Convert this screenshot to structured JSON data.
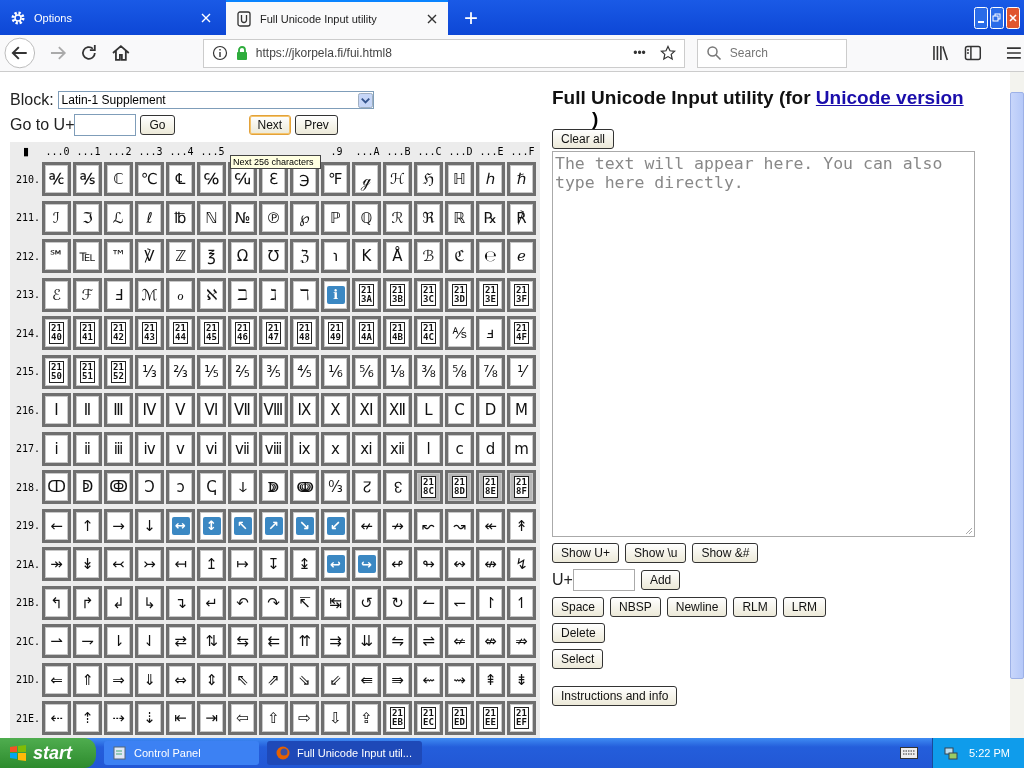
{
  "browser": {
    "tabs": [
      {
        "title": "Options",
        "selected": false
      },
      {
        "title": "Full Unicode Input utility",
        "selected": true
      }
    ],
    "new_tab": "+",
    "url": "https://jkorpela.fi/fui.html8",
    "page_actions": "•••",
    "search": {
      "placeholder": "Search"
    }
  },
  "page": {
    "block_label": "Block:",
    "block_value": "Latin-1 Supplement",
    "goto_label": "Go to U+",
    "go": "Go",
    "nav_buttons": [
      {
        "label": "Next",
        "hover": true
      },
      {
        "label": "Prev",
        "hover": false
      }
    ],
    "corner": "▮",
    "column_headers": [
      "...0",
      "...1",
      "...2",
      "...3",
      "...4",
      "...5"
    ],
    "tooltip": "Next 256 characters",
    "column_headers_after": [
      ".9",
      "...A",
      "...B",
      "...C",
      "...D",
      "...E",
      "...F"
    ],
    "rows": [
      {
        "label": "210.",
        "cells": [
          {
            "kind": "char",
            "text": "℀"
          },
          {
            "kind": "char",
            "text": "℁"
          },
          {
            "kind": "char",
            "text": "ℂ"
          },
          {
            "kind": "char",
            "text": "℃"
          },
          {
            "kind": "char",
            "text": "℄"
          },
          {
            "kind": "char",
            "text": "℅"
          },
          {
            "kind": "char",
            "text": "℆"
          },
          {
            "kind": "char",
            "text": "ℇ"
          },
          {
            "kind": "char",
            "text": "℈"
          },
          {
            "kind": "char",
            "text": "℉"
          },
          {
            "kind": "char",
            "text": "ℊ"
          },
          {
            "kind": "char",
            "text": "ℋ"
          },
          {
            "kind": "char",
            "text": "ℌ"
          },
          {
            "kind": "char",
            "text": "ℍ"
          },
          {
            "kind": "char",
            "text": "ℎ"
          },
          {
            "kind": "char",
            "text": "ℏ"
          }
        ]
      },
      {
        "label": "211.",
        "cells": [
          {
            "kind": "char",
            "text": "ℐ"
          },
          {
            "kind": "char",
            "text": "ℑ"
          },
          {
            "kind": "char",
            "text": "ℒ"
          },
          {
            "kind": "char",
            "text": "ℓ"
          },
          {
            "kind": "char",
            "text": "℔"
          },
          {
            "kind": "char",
            "text": "ℕ"
          },
          {
            "kind": "char",
            "text": "№"
          },
          {
            "kind": "char",
            "text": "℗"
          },
          {
            "kind": "char",
            "text": "℘"
          },
          {
            "kind": "char",
            "text": "ℙ"
          },
          {
            "kind": "char",
            "text": "ℚ"
          },
          {
            "kind": "char",
            "text": "ℛ"
          },
          {
            "kind": "char",
            "text": "ℜ"
          },
          {
            "kind": "char",
            "text": "ℝ"
          },
          {
            "kind": "char",
            "text": "℞"
          },
          {
            "kind": "char",
            "text": "℟"
          }
        ]
      },
      {
        "label": "212.",
        "cells": [
          {
            "kind": "char",
            "text": "℠"
          },
          {
            "kind": "char",
            "text": "℡"
          },
          {
            "kind": "char",
            "text": "™"
          },
          {
            "kind": "char",
            "text": "℣"
          },
          {
            "kind": "char",
            "text": "ℤ"
          },
          {
            "kind": "char",
            "text": "℥"
          },
          {
            "kind": "char",
            "text": "Ω"
          },
          {
            "kind": "char",
            "text": "℧"
          },
          {
            "kind": "char",
            "text": "ℨ"
          },
          {
            "kind": "char",
            "text": "℩"
          },
          {
            "kind": "char",
            "text": "K"
          },
          {
            "kind": "char",
            "text": "Å"
          },
          {
            "kind": "char",
            "text": "ℬ"
          },
          {
            "kind": "char",
            "text": "ℭ"
          },
          {
            "kind": "char",
            "text": "℮"
          },
          {
            "kind": "char",
            "text": "ℯ"
          }
        ]
      },
      {
        "label": "213.",
        "cells": [
          {
            "kind": "char",
            "text": "ℰ"
          },
          {
            "kind": "char",
            "text": "ℱ"
          },
          {
            "kind": "char",
            "text": "Ⅎ"
          },
          {
            "kind": "char",
            "text": "ℳ"
          },
          {
            "kind": "char",
            "text": "ℴ"
          },
          {
            "kind": "char",
            "text": "ℵ"
          },
          {
            "kind": "char",
            "text": "ℶ"
          },
          {
            "kind": "char",
            "text": "ℷ"
          },
          {
            "kind": "char",
            "text": "ℸ"
          },
          {
            "kind": "emoji",
            "text": "ℹ"
          },
          {
            "kind": "code",
            "text": "213A"
          },
          {
            "kind": "code",
            "text": "213B"
          },
          {
            "kind": "code",
            "text": "213C"
          },
          {
            "kind": "code",
            "text": "213D"
          },
          {
            "kind": "code",
            "text": "213E"
          },
          {
            "kind": "code",
            "text": "213F"
          }
        ]
      },
      {
        "label": "214.",
        "cells": [
          {
            "kind": "code",
            "text": "2140"
          },
          {
            "kind": "code",
            "text": "2141"
          },
          {
            "kind": "code",
            "text": "2142"
          },
          {
            "kind": "code",
            "text": "2143"
          },
          {
            "kind": "code",
            "text": "2144"
          },
          {
            "kind": "code",
            "text": "2145"
          },
          {
            "kind": "code",
            "text": "2146"
          },
          {
            "kind": "code",
            "text": "2147"
          },
          {
            "kind": "code",
            "text": "2148"
          },
          {
            "kind": "code",
            "text": "2149"
          },
          {
            "kind": "code",
            "text": "214A"
          },
          {
            "kind": "code",
            "text": "214B"
          },
          {
            "kind": "code",
            "text": "214C"
          },
          {
            "kind": "char",
            "text": "⅍"
          },
          {
            "kind": "char",
            "text": "ⅎ"
          },
          {
            "kind": "code",
            "text": "214F"
          }
        ]
      },
      {
        "label": "215.",
        "cells": [
          {
            "kind": "code",
            "text": "2150"
          },
          {
            "kind": "code",
            "text": "2151"
          },
          {
            "kind": "code",
            "text": "2152"
          },
          {
            "kind": "char",
            "text": "⅓"
          },
          {
            "kind": "char",
            "text": "⅔"
          },
          {
            "kind": "char",
            "text": "⅕"
          },
          {
            "kind": "char",
            "text": "⅖"
          },
          {
            "kind": "char",
            "text": "⅗"
          },
          {
            "kind": "char",
            "text": "⅘"
          },
          {
            "kind": "char",
            "text": "⅙"
          },
          {
            "kind": "char",
            "text": "⅚"
          },
          {
            "kind": "char",
            "text": "⅛"
          },
          {
            "kind": "char",
            "text": "⅜"
          },
          {
            "kind": "char",
            "text": "⅝"
          },
          {
            "kind": "char",
            "text": "⅞"
          },
          {
            "kind": "char",
            "text": "⅟"
          }
        ]
      },
      {
        "label": "216.",
        "cells": [
          {
            "kind": "char",
            "text": "Ⅰ"
          },
          {
            "kind": "char",
            "text": "Ⅱ"
          },
          {
            "kind": "char",
            "text": "Ⅲ"
          },
          {
            "kind": "char",
            "text": "Ⅳ"
          },
          {
            "kind": "char",
            "text": "Ⅴ"
          },
          {
            "kind": "char",
            "text": "Ⅵ"
          },
          {
            "kind": "char",
            "text": "Ⅶ"
          },
          {
            "kind": "char",
            "text": "Ⅷ"
          },
          {
            "kind": "char",
            "text": "Ⅸ"
          },
          {
            "kind": "char",
            "text": "Ⅹ"
          },
          {
            "kind": "char",
            "text": "Ⅺ"
          },
          {
            "kind": "char",
            "text": "Ⅻ"
          },
          {
            "kind": "char",
            "text": "Ⅼ"
          },
          {
            "kind": "char",
            "text": "Ⅽ"
          },
          {
            "kind": "char",
            "text": "Ⅾ"
          },
          {
            "kind": "char",
            "text": "Ⅿ"
          }
        ]
      },
      {
        "label": "217.",
        "cells": [
          {
            "kind": "char",
            "text": "ⅰ"
          },
          {
            "kind": "char",
            "text": "ⅱ"
          },
          {
            "kind": "char",
            "text": "ⅲ"
          },
          {
            "kind": "char",
            "text": "ⅳ"
          },
          {
            "kind": "char",
            "text": "ⅴ"
          },
          {
            "kind": "char",
            "text": "ⅵ"
          },
          {
            "kind": "char",
            "text": "ⅶ"
          },
          {
            "kind": "char",
            "text": "ⅷ"
          },
          {
            "kind": "char",
            "text": "ⅸ"
          },
          {
            "kind": "char",
            "text": "ⅹ"
          },
          {
            "kind": "char",
            "text": "ⅺ"
          },
          {
            "kind": "char",
            "text": "ⅻ"
          },
          {
            "kind": "char",
            "text": "ⅼ"
          },
          {
            "kind": "char",
            "text": "ⅽ"
          },
          {
            "kind": "char",
            "text": "ⅾ"
          },
          {
            "kind": "char",
            "text": "ⅿ"
          }
        ]
      },
      {
        "label": "218.",
        "cells": [
          {
            "kind": "char",
            "text": "ↀ"
          },
          {
            "kind": "char",
            "text": "ↁ"
          },
          {
            "kind": "char",
            "text": "ↂ"
          },
          {
            "kind": "char",
            "text": "Ↄ"
          },
          {
            "kind": "char",
            "text": "ↄ"
          },
          {
            "kind": "char",
            "text": "ↅ"
          },
          {
            "kind": "char",
            "text": "ↆ"
          },
          {
            "kind": "char",
            "text": "ↇ"
          },
          {
            "kind": "char",
            "text": "ↈ"
          },
          {
            "kind": "char",
            "text": "↉"
          },
          {
            "kind": "char",
            "text": "↊"
          },
          {
            "kind": "char",
            "text": "↋"
          },
          {
            "kind": "code-shaded",
            "text": "218C"
          },
          {
            "kind": "code-shaded",
            "text": "218D"
          },
          {
            "kind": "code-shaded",
            "text": "218E"
          },
          {
            "kind": "code-shaded",
            "text": "218F"
          }
        ]
      },
      {
        "label": "219.",
        "cells": [
          {
            "kind": "char",
            "text": "←"
          },
          {
            "kind": "char",
            "text": "↑"
          },
          {
            "kind": "char",
            "text": "→"
          },
          {
            "kind": "char",
            "text": "↓"
          },
          {
            "kind": "emoji",
            "text": "↔"
          },
          {
            "kind": "emoji",
            "text": "↕"
          },
          {
            "kind": "emoji",
            "text": "↖"
          },
          {
            "kind": "emoji",
            "text": "↗"
          },
          {
            "kind": "emoji",
            "text": "↘"
          },
          {
            "kind": "emoji",
            "text": "↙"
          },
          {
            "kind": "char",
            "text": "↚"
          },
          {
            "kind": "char",
            "text": "↛"
          },
          {
            "kind": "char",
            "text": "↜"
          },
          {
            "kind": "char",
            "text": "↝"
          },
          {
            "kind": "char",
            "text": "↞"
          },
          {
            "kind": "char",
            "text": "↟"
          }
        ]
      },
      {
        "label": "21A.",
        "cells": [
          {
            "kind": "char",
            "text": "↠"
          },
          {
            "kind": "char",
            "text": "↡"
          },
          {
            "kind": "char",
            "text": "↢"
          },
          {
            "kind": "char",
            "text": "↣"
          },
          {
            "kind": "char",
            "text": "↤"
          },
          {
            "kind": "char",
            "text": "↥"
          },
          {
            "kind": "char",
            "text": "↦"
          },
          {
            "kind": "char",
            "text": "↧"
          },
          {
            "kind": "char",
            "text": "↨"
          },
          {
            "kind": "emoji",
            "text": "↩"
          },
          {
            "kind": "emoji",
            "text": "↪"
          },
          {
            "kind": "char",
            "text": "↫"
          },
          {
            "kind": "char",
            "text": "↬"
          },
          {
            "kind": "char",
            "text": "↭"
          },
          {
            "kind": "char",
            "text": "↮"
          },
          {
            "kind": "char",
            "text": "↯"
          }
        ]
      },
      {
        "label": "21B.",
        "cells": [
          {
            "kind": "char",
            "text": "↰"
          },
          {
            "kind": "char",
            "text": "↱"
          },
          {
            "kind": "char",
            "text": "↲"
          },
          {
            "kind": "char",
            "text": "↳"
          },
          {
            "kind": "char",
            "text": "↴"
          },
          {
            "kind": "char",
            "text": "↵"
          },
          {
            "kind": "char",
            "text": "↶"
          },
          {
            "kind": "char",
            "text": "↷"
          },
          {
            "kind": "char",
            "text": "↸"
          },
          {
            "kind": "char",
            "text": "↹"
          },
          {
            "kind": "char",
            "text": "↺"
          },
          {
            "kind": "char",
            "text": "↻"
          },
          {
            "kind": "char",
            "text": "↼"
          },
          {
            "kind": "char",
            "text": "↽"
          },
          {
            "kind": "char",
            "text": "↾"
          },
          {
            "kind": "char",
            "text": "↿"
          }
        ]
      },
      {
        "label": "21C.",
        "cells": [
          {
            "kind": "char",
            "text": "⇀"
          },
          {
            "kind": "char",
            "text": "⇁"
          },
          {
            "kind": "char",
            "text": "⇂"
          },
          {
            "kind": "char",
            "text": "⇃"
          },
          {
            "kind": "char",
            "text": "⇄"
          },
          {
            "kind": "char",
            "text": "⇅"
          },
          {
            "kind": "char",
            "text": "⇆"
          },
          {
            "kind": "char",
            "text": "⇇"
          },
          {
            "kind": "char",
            "text": "⇈"
          },
          {
            "kind": "char",
            "text": "⇉"
          },
          {
            "kind": "char",
            "text": "⇊"
          },
          {
            "kind": "char",
            "text": "⇋"
          },
          {
            "kind": "char",
            "text": "⇌"
          },
          {
            "kind": "char",
            "text": "⇍"
          },
          {
            "kind": "char",
            "text": "⇎"
          },
          {
            "kind": "char",
            "text": "⇏"
          }
        ]
      },
      {
        "label": "21D.",
        "cells": [
          {
            "kind": "char",
            "text": "⇐"
          },
          {
            "kind": "char",
            "text": "⇑"
          },
          {
            "kind": "char",
            "text": "⇒"
          },
          {
            "kind": "char",
            "text": "⇓"
          },
          {
            "kind": "char",
            "text": "⇔"
          },
          {
            "kind": "char",
            "text": "⇕"
          },
          {
            "kind": "char",
            "text": "⇖"
          },
          {
            "kind": "char",
            "text": "⇗"
          },
          {
            "kind": "char",
            "text": "⇘"
          },
          {
            "kind": "char",
            "text": "⇙"
          },
          {
            "kind": "char",
            "text": "⇚"
          },
          {
            "kind": "char",
            "text": "⇛"
          },
          {
            "kind": "char",
            "text": "⇜"
          },
          {
            "kind": "char",
            "text": "⇝"
          },
          {
            "kind": "char",
            "text": "⇞"
          },
          {
            "kind": "char",
            "text": "⇟"
          }
        ]
      },
      {
        "label": "21E.",
        "cells": [
          {
            "kind": "char",
            "text": "⇠"
          },
          {
            "kind": "char",
            "text": "⇡"
          },
          {
            "kind": "char",
            "text": "⇢"
          },
          {
            "kind": "char",
            "text": "⇣"
          },
          {
            "kind": "char",
            "text": "⇤"
          },
          {
            "kind": "char",
            "text": "⇥"
          },
          {
            "kind": "char",
            "text": "⇦"
          },
          {
            "kind": "char",
            "text": "⇧"
          },
          {
            "kind": "char",
            "text": "⇨"
          },
          {
            "kind": "char",
            "text": "⇩"
          },
          {
            "kind": "char",
            "text": "⇪"
          },
          {
            "kind": "code",
            "text": "21EB"
          },
          {
            "kind": "code",
            "text": "21EC"
          },
          {
            "kind": "code",
            "text": "21ED"
          },
          {
            "kind": "code",
            "text": "21EE"
          },
          {
            "kind": "code",
            "text": "21EF"
          }
        ]
      }
    ]
  },
  "panel": {
    "title": "Full Unicode Input utility (for ",
    "link": "Unicode version",
    "title_end": ")",
    "clear": "Clear all",
    "text_placeholder": "The text will appear here. You can also type here directly.",
    "show_buttons": [
      "Show U+",
      "Show \\u",
      "Show &#"
    ],
    "add_label": "U+",
    "add": "Add",
    "insert_buttons": [
      "Space",
      "NBSP",
      "Newline",
      "RLM",
      "LRM"
    ],
    "delete": "Delete",
    "select": "Select",
    "instructions": "Instructions and info"
  },
  "taskbar": {
    "start": "start",
    "tasks": [
      {
        "title": "Control Panel",
        "selected": false
      },
      {
        "title": "Full Unicode Input util...",
        "selected": true
      }
    ],
    "clock": "5:22 PM"
  }
}
